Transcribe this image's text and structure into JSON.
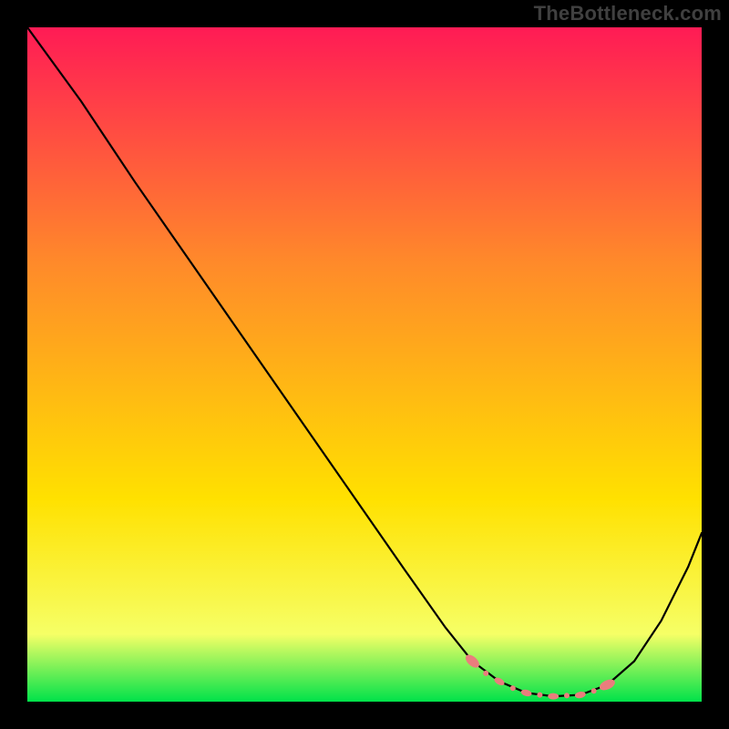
{
  "watermark": "TheBottleneck.com",
  "chart_data": {
    "type": "line",
    "title": "",
    "xlabel": "",
    "ylabel": "",
    "xlim": [
      0,
      100
    ],
    "ylim": [
      0,
      100
    ],
    "grid": false,
    "series": [
      {
        "name": "curve",
        "x": [
          0,
          8,
          16,
          24,
          32,
          40,
          48,
          56,
          62,
          66,
          70,
          74,
          78,
          82,
          86,
          90,
          94,
          98,
          100
        ],
        "y": [
          100,
          89,
          77,
          65.5,
          54,
          42.5,
          31,
          19.5,
          11,
          6,
          3,
          1.3,
          0.8,
          1.0,
          2.5,
          6,
          12,
          20,
          25
        ]
      },
      {
        "name": "marked-band",
        "x": [
          66,
          68,
          70,
          72,
          74,
          76,
          78,
          80,
          82,
          84,
          86
        ],
        "y": [
          6,
          4.2,
          3,
          2,
          1.3,
          1.0,
          0.8,
          0.9,
          1.0,
          1.6,
          2.5
        ]
      }
    ],
    "background_gradient": {
      "top": "#ff1b55",
      "mid": "#ffe100",
      "bottom": "#00e24a"
    },
    "colors": {
      "curve": "#000000",
      "markers": "#ea7d7d"
    }
  }
}
